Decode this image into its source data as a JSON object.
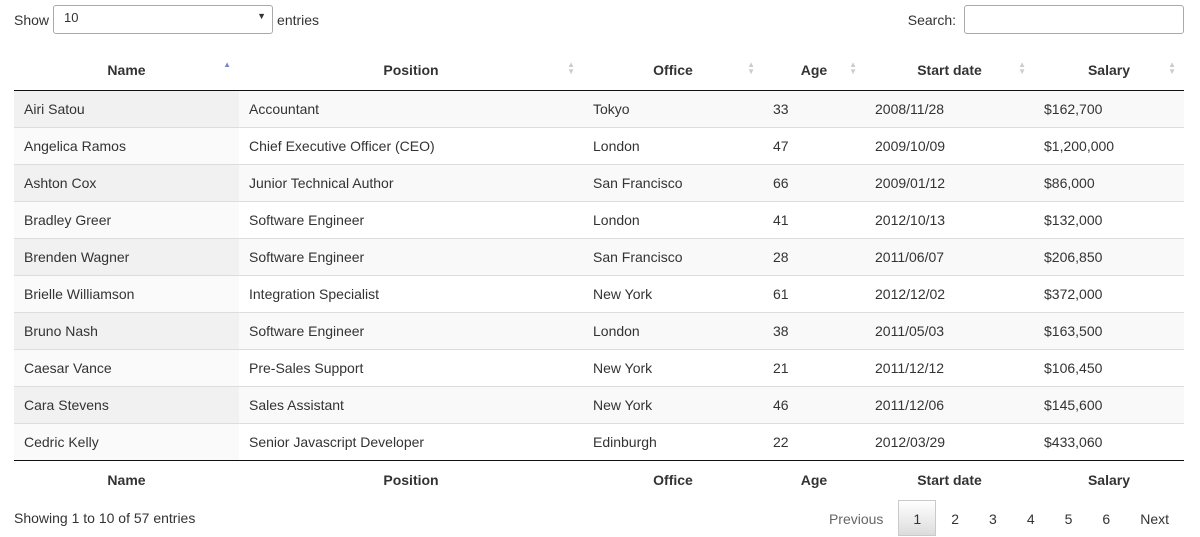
{
  "length": {
    "label_before": "Show",
    "value": "10",
    "label_after": "entries"
  },
  "search": {
    "label": "Search:",
    "value": ""
  },
  "columns": [
    "Name",
    "Position",
    "Office",
    "Age",
    "Start date",
    "Salary"
  ],
  "sort": {
    "column": "Name",
    "direction": "ascending"
  },
  "rows": [
    [
      "Airi Satou",
      "Accountant",
      "Tokyo",
      "33",
      "2008/11/28",
      "$162,700"
    ],
    [
      "Angelica Ramos",
      "Chief Executive Officer (CEO)",
      "London",
      "47",
      "2009/10/09",
      "$1,200,000"
    ],
    [
      "Ashton Cox",
      "Junior Technical Author",
      "San Francisco",
      "66",
      "2009/01/12",
      "$86,000"
    ],
    [
      "Bradley Greer",
      "Software Engineer",
      "London",
      "41",
      "2012/10/13",
      "$132,000"
    ],
    [
      "Brenden Wagner",
      "Software Engineer",
      "San Francisco",
      "28",
      "2011/06/07",
      "$206,850"
    ],
    [
      "Brielle Williamson",
      "Integration Specialist",
      "New York",
      "61",
      "2012/12/02",
      "$372,000"
    ],
    [
      "Bruno Nash",
      "Software Engineer",
      "London",
      "38",
      "2011/05/03",
      "$163,500"
    ],
    [
      "Caesar Vance",
      "Pre-Sales Support",
      "New York",
      "21",
      "2011/12/12",
      "$106,450"
    ],
    [
      "Cara Stevens",
      "Sales Assistant",
      "New York",
      "46",
      "2011/12/06",
      "$145,600"
    ],
    [
      "Cedric Kelly",
      "Senior Javascript Developer",
      "Edinburgh",
      "22",
      "2012/03/29",
      "$433,060"
    ]
  ],
  "info": "Showing 1 to 10 of 57 entries",
  "pagination": {
    "previous": "Previous",
    "pages": [
      "1",
      "2",
      "3",
      "4",
      "5",
      "6"
    ],
    "current": "1",
    "next": "Next"
  }
}
